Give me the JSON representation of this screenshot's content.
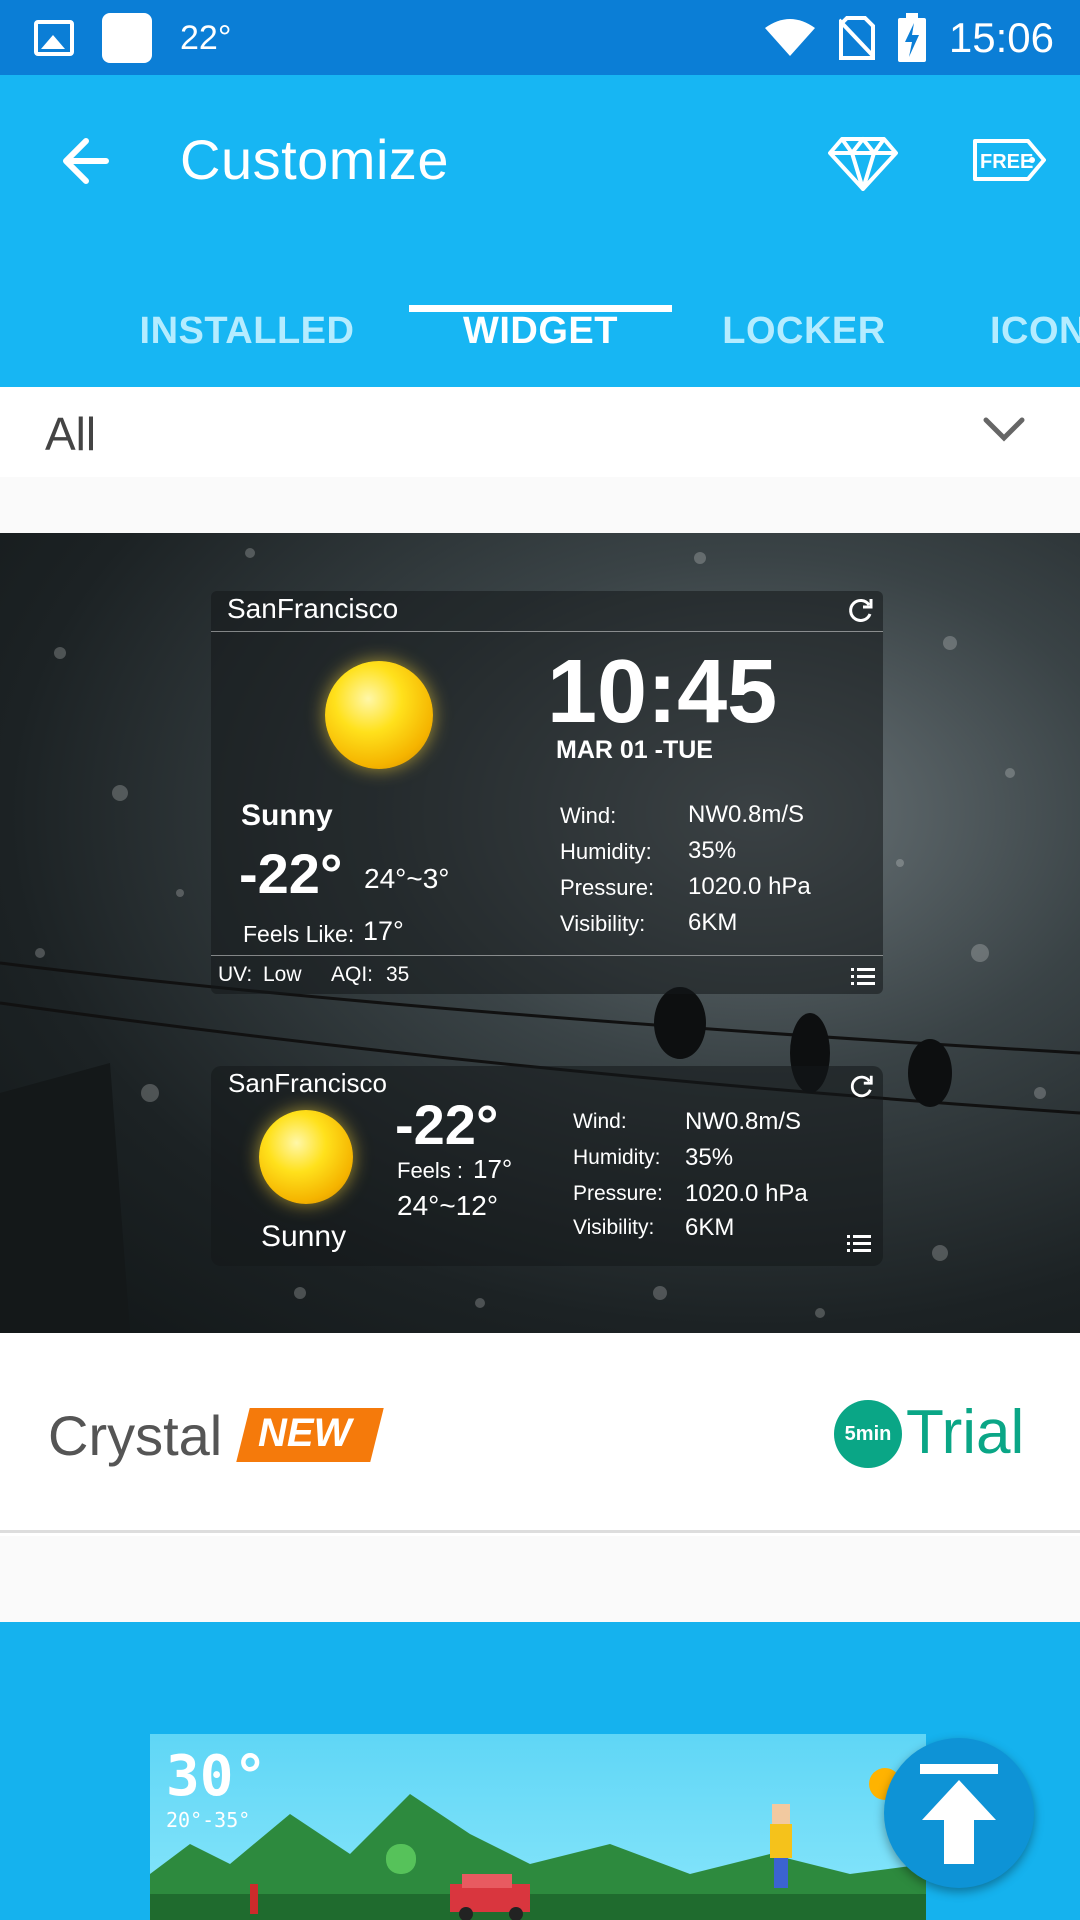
{
  "status_bar": {
    "temperature": "22°",
    "time": "15:06"
  },
  "app_bar": {
    "title": "Customize"
  },
  "tabs": [
    {
      "label": "INSTALLED",
      "active": false
    },
    {
      "label": "WIDGET",
      "active": true
    },
    {
      "label": "LOCKER",
      "active": false
    },
    {
      "label": "ICON",
      "active": false
    }
  ],
  "filter": {
    "selected": "All"
  },
  "widget_card": {
    "large_widget": {
      "city": "SanFrancisco",
      "time": "10:45",
      "date": "MAR  01 -TUE",
      "condition": "Sunny",
      "temperature": "-22°",
      "range": "24°~3°",
      "feels_like_label": "Feels Like:",
      "feels_like_value": "17°",
      "wind_label": "Wind:",
      "wind_value": "NW0.8m/S",
      "humidity_label": "Humidity:",
      "humidity_value": "35%",
      "pressure_label": "Pressure:",
      "pressure_value": "1020.0 hPa",
      "visibility_label": "Visibility:",
      "visibility_value": "6KM",
      "uv_label": "UV:",
      "uv_value": "Low",
      "aqi_label": "AQI:",
      "aqi_value": "35"
    },
    "small_widget": {
      "city": "SanFrancisco",
      "condition": "Sunny",
      "temperature": "-22°",
      "feels_label": "Feels :",
      "feels_value": "17°",
      "range": "24°~12°",
      "wind_label": "Wind:",
      "wind_value": "NW0.8m/S",
      "humidity_label": "Humidity:",
      "humidity_value": "35%",
      "pressure_label": "Pressure:",
      "pressure_value": "1020.0 hPa",
      "visibility_label": "Visibility:",
      "visibility_value": "6KM"
    },
    "name": "Crystal",
    "badge": "NEW",
    "trial_duration": "5min",
    "trial_label": "Trial",
    "colors": {
      "badge": "#f57a0b",
      "trial": "#0aa686"
    }
  },
  "second_card": {
    "temperature": "30°",
    "range": "20°-35°"
  },
  "colors": {
    "status_bar": "#0b7ed6",
    "app_bar": "#17b6f3",
    "tab_inactive": "#b5ecff",
    "fab": "#0e93d6"
  }
}
